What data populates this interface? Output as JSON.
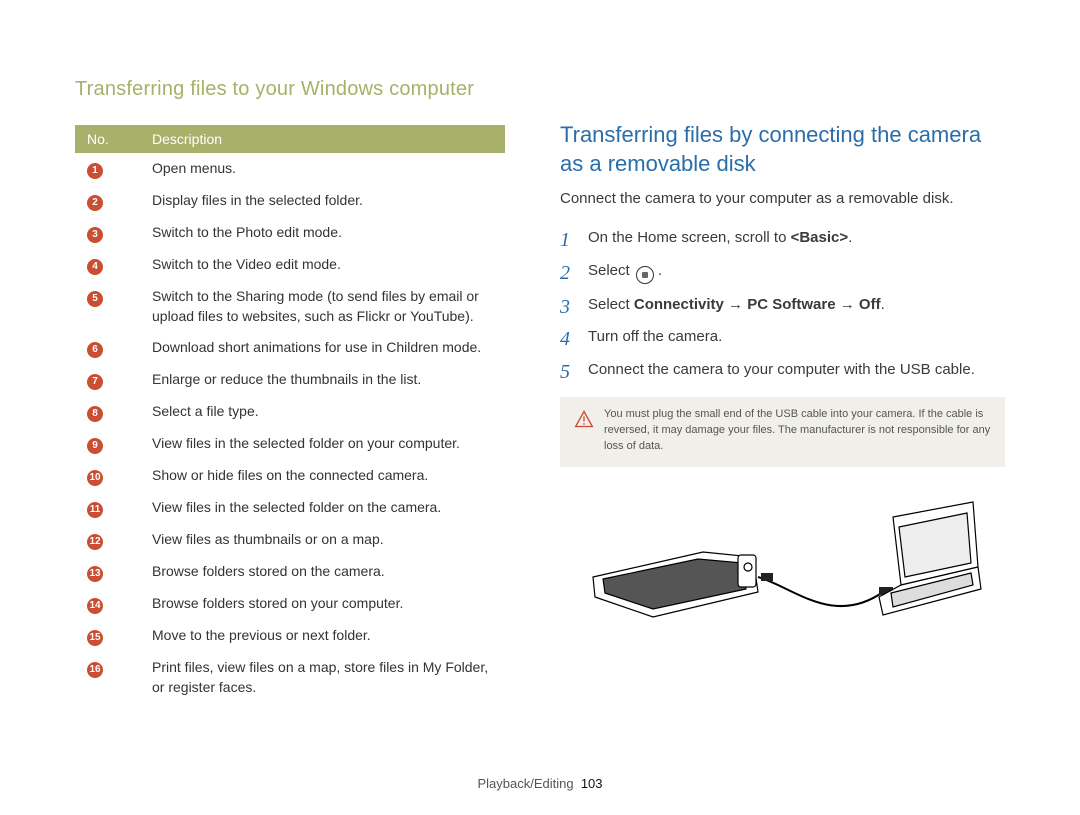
{
  "header": {
    "title": "Transferring files to your Windows computer"
  },
  "table": {
    "head_no": "No.",
    "head_desc": "Description",
    "rows": [
      {
        "n": "1",
        "d": "Open menus."
      },
      {
        "n": "2",
        "d": "Display files in the selected folder."
      },
      {
        "n": "3",
        "d": "Switch to the Photo edit mode."
      },
      {
        "n": "4",
        "d": "Switch to the Video edit mode."
      },
      {
        "n": "5",
        "d": "Switch to the Sharing mode (to send files by email or upload files to websites, such as Flickr or YouTube)."
      },
      {
        "n": "6",
        "d": "Download short animations for use in Children mode."
      },
      {
        "n": "7",
        "d": "Enlarge or reduce the thumbnails in the list."
      },
      {
        "n": "8",
        "d": "Select a file type."
      },
      {
        "n": "9",
        "d": "View files in the selected folder on your computer."
      },
      {
        "n": "10",
        "d": "Show or hide files on the connected camera."
      },
      {
        "n": "11",
        "d": "View files in the selected folder on the camera."
      },
      {
        "n": "12",
        "d": "View files as thumbnails or on a map."
      },
      {
        "n": "13",
        "d": "Browse folders stored on the camera."
      },
      {
        "n": "14",
        "d": "Browse folders stored on your computer."
      },
      {
        "n": "15",
        "d": "Move to the previous or next folder."
      },
      {
        "n": "16",
        "d": "Print files, view files on a map, store files in My Folder, or register faces."
      }
    ]
  },
  "section": {
    "title": "Transferring files by connecting the camera as a removable disk",
    "intro": "Connect the camera to your computer as a removable disk."
  },
  "steps": {
    "s1_pre": "On the Home screen, scroll to ",
    "s1_bold": "<Basic>",
    "s1_post": ".",
    "s2_pre": "Select ",
    "s2_post": " .",
    "s3_pre": "Select ",
    "s3_b1": "Connectivity",
    "s3_arrow1": " → ",
    "s3_b2": "PC Software",
    "s3_arrow2": " → ",
    "s3_b3": "Off",
    "s3_post": ".",
    "s4": "Turn off the camera.",
    "s5": "Connect the camera to your computer with the USB cable."
  },
  "note": {
    "text": "You must plug the small end of the USB cable into your camera. If the cable is reversed, it may damage your files. The manufacturer is not responsible for any loss of data."
  },
  "footer": {
    "section": "Playback/Editing",
    "page": "103"
  }
}
